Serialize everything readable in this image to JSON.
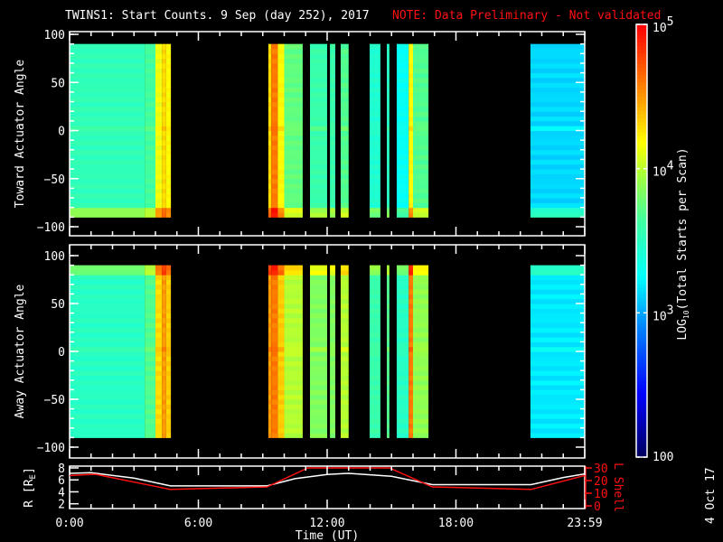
{
  "title": "TWINS1: Start Counts.  9 Sep (day 252), 2017",
  "note": "NOTE: Data Preliminary - Not validated",
  "date_stamp": "4 Oct 17",
  "chart_data": [
    {
      "type": "heatmap",
      "name": "toward",
      "ylabel": "Toward Actuator Angle",
      "ylim": [
        -110,
        110
      ],
      "yticks": [
        100,
        50,
        0,
        -50,
        -100
      ],
      "angle_range": [
        -90,
        90
      ],
      "xlim_hours": [
        0,
        24
      ],
      "columns_note": "start_hour, end_hour, log10 counts",
      "columns": [
        [
          0,
          3.5,
          3.55
        ],
        [
          3.5,
          4.0,
          3.65
        ],
        [
          4.0,
          4.3,
          4.15
        ],
        [
          4.3,
          4.5,
          4.3
        ],
        [
          4.5,
          4.72,
          4.2
        ],
        [
          9.26,
          9.4,
          4.3
        ],
        [
          9.4,
          9.7,
          4.6
        ],
        [
          9.7,
          10.0,
          4.2
        ],
        [
          10.0,
          10.86,
          3.75
        ],
        [
          11.2,
          12.0,
          3.6
        ],
        [
          12.13,
          12.38,
          3.6
        ],
        [
          12.63,
          13.0,
          3.7
        ],
        [
          13.98,
          14.48,
          3.45
        ],
        [
          14.78,
          14.9,
          3.5
        ],
        [
          15.24,
          15.8,
          3.3
        ],
        [
          15.8,
          16.0,
          4.2
        ],
        [
          16.0,
          16.72,
          3.7
        ],
        [
          21.47,
          24.0,
          3.15
        ]
      ]
    },
    {
      "type": "heatmap",
      "name": "away",
      "ylabel": "Away Actuator Angle",
      "ylim": [
        -110,
        110
      ],
      "yticks": [
        100,
        50,
        0,
        -50,
        -100
      ],
      "angle_range": [
        -90,
        90
      ],
      "xlim_hours": [
        0,
        24
      ],
      "columns": [
        [
          0,
          3.5,
          3.5
        ],
        [
          3.5,
          4.0,
          3.7
        ],
        [
          4.0,
          4.3,
          4.3
        ],
        [
          4.3,
          4.5,
          4.5
        ],
        [
          4.5,
          4.72,
          4.35
        ],
        [
          9.26,
          9.4,
          4.5
        ],
        [
          9.4,
          9.7,
          4.6
        ],
        [
          9.7,
          10.0,
          4.35
        ],
        [
          10.0,
          10.86,
          4.0
        ],
        [
          11.2,
          12.0,
          3.85
        ],
        [
          12.13,
          12.38,
          3.85
        ],
        [
          12.63,
          13.0,
          4.0
        ],
        [
          13.98,
          14.48,
          3.6
        ],
        [
          14.78,
          14.9,
          3.7
        ],
        [
          15.24,
          15.8,
          3.5
        ],
        [
          15.8,
          16.0,
          4.6
        ],
        [
          16.0,
          16.72,
          3.9
        ],
        [
          21.47,
          24.0,
          3.2
        ]
      ]
    },
    {
      "type": "line",
      "name": "orbit",
      "xlabel": "Time (UT)",
      "xticklabels": [
        "0:00",
        "6:00",
        "12:00",
        "18:00",
        "23:59"
      ],
      "xticks_hours": [
        0,
        6,
        12,
        18,
        24
      ],
      "ylabel_left": "R [R",
      "ylabel_left_sub": "E",
      "ylabel_left_end": "]",
      "ylabel_right": "L Shell",
      "ylim_left": [
        1.5,
        8
      ],
      "yticks_left": [
        8,
        6,
        4,
        2
      ],
      "ylim_right": [
        0,
        30
      ],
      "yticks_right": [
        30,
        20,
        10,
        0
      ],
      "series": [
        {
          "name": "R",
          "color": "#ffffff",
          "x": [
            0,
            1,
            3,
            4.7,
            9.2,
            10.5,
            12,
            13,
            15,
            16.9,
            21.5,
            23,
            24
          ],
          "y": [
            7.1,
            7.2,
            6.3,
            5.0,
            5.0,
            6.2,
            6.9,
            7.1,
            6.6,
            5.2,
            5.2,
            6.4,
            7.0
          ]
        },
        {
          "name": "L Shell",
          "color": "#ff1010",
          "x": [
            0,
            1.2,
            4.7,
            9.2,
            11.1,
            14.9,
            16.9,
            21.5,
            24
          ],
          "y": [
            24,
            25,
            13,
            15,
            30,
            30,
            15,
            13,
            24
          ]
        }
      ]
    },
    {
      "type": "colorbar",
      "label": "LOG",
      "label_sub": "10",
      "label_rest": "(Total Starts per Scan)",
      "range_log10": [
        2,
        5
      ],
      "ticks": [
        {
          "base": "10",
          "exp": "5",
          "v": 5
        },
        {
          "base": "10",
          "exp": "4",
          "v": 4
        },
        {
          "base": "10",
          "exp": "3",
          "v": 3
        },
        {
          "base": "100",
          "exp": "",
          "v": 2
        }
      ]
    }
  ]
}
